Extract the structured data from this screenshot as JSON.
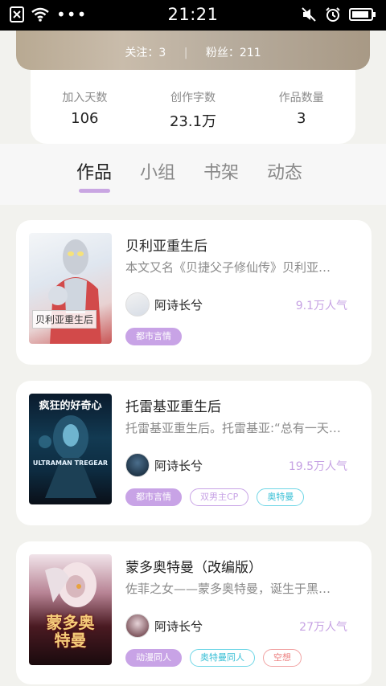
{
  "status": {
    "time": "21:21"
  },
  "banner": {
    "follow": "关注：3",
    "fans": "粉丝：211"
  },
  "stats": [
    {
      "label": "加入天数",
      "value": "106"
    },
    {
      "label": "创作字数",
      "value": "23.1万"
    },
    {
      "label": "作品数量",
      "value": "3"
    }
  ],
  "tabs": [
    "作品",
    "小组",
    "书架",
    "动态"
  ],
  "books": [
    {
      "title": "贝利亚重生后",
      "desc": "本文又名《贝捷父子修仙传》贝利亚…",
      "author": "阿诗长兮",
      "popularity": "9.1万人气",
      "cover_label": "贝利亚重生后",
      "tags": [
        "都市言情"
      ]
    },
    {
      "title": "托雷基亚重生后",
      "desc": "托雷基亚重生后。托雷基亚:“总有一天…",
      "author": "阿诗长兮",
      "popularity": "19.5万人气",
      "cover_top": "疯狂的好奇心",
      "cover_mid": "ULTRAMAN TREGEAR",
      "tags": [
        "都市言情",
        "双男主CP",
        "奥特曼"
      ]
    },
    {
      "title": "蒙多奥特曼（改编版）",
      "desc": "佐菲之女——蒙多奥特曼，诞生于黑…",
      "author": "阿诗长兮",
      "popularity": "27万人气",
      "cover_big": "蒙多奥特曼",
      "tags": [
        "动漫同人",
        "奥特曼同人",
        "空想"
      ]
    }
  ]
}
